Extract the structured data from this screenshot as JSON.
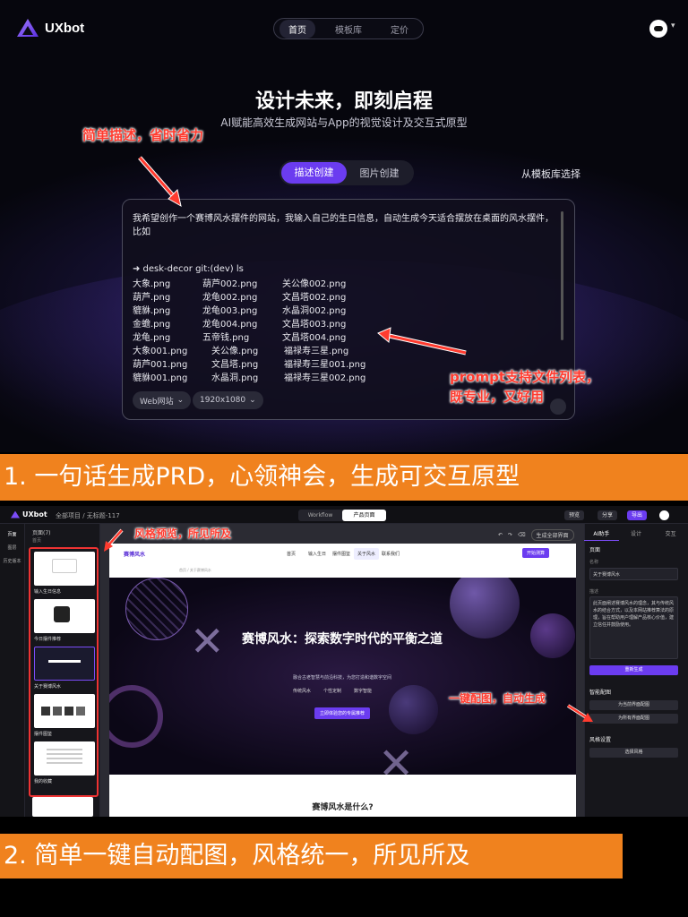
{
  "top": {
    "logo_text": "UXbot",
    "nav": [
      "首页",
      "模板库",
      "定价"
    ],
    "hero_title": "设计未来，即刻启程",
    "hero_subtitle": "AI赋能高效生成网站与App的视觉设计及交互式原型",
    "annotation_1": "简单描述，省时省力",
    "segment": [
      "描述创建",
      "图片创建"
    ],
    "template_link": "从模板库选择",
    "prompt_text": "我希望创作一个赛博风水摆件的网站，我输入自己的生日信息，自动生成今天适合摆放在桌面的风水摆件，比如",
    "command": "➜  desk-decor git:(dev) ls",
    "files": [
      [
        "大象.png",
        "葫芦002.png",
        "关公像002.png"
      ],
      [
        "葫芦.png",
        "龙龟002.png",
        "文昌塔002.png"
      ],
      [
        "貔貅.png",
        "龙龟003.png",
        "水晶洞002.png"
      ],
      [
        "金蟾.png",
        "龙龟004.png",
        "文昌塔003.png"
      ],
      [
        "龙龟.png",
        "五帝钱.png",
        "文昌塔004.png"
      ],
      [
        "大象001.png",
        "关公像.png",
        "福禄寿三星.png"
      ],
      [
        "葫芦001.png",
        "文昌塔.png",
        "福禄寿三星001.png"
      ],
      [
        "貔貅001.png",
        "水晶洞.png",
        "福禄寿三星002.png"
      ]
    ],
    "chip_platform": "Web网站",
    "chip_size": "1920x1080",
    "annotation_2": [
      "prompt支持文件列表，",
      "既专业，又好用"
    ]
  },
  "banner_1": "1. 一句话生成PRD，心领神会，生成可交互原型",
  "editor": {
    "logo_text": "UXbot",
    "breadcrumb": "全部项目 / 无标题-117",
    "toggle": [
      "Workflow",
      "产品页面"
    ],
    "buttons": [
      "预览",
      "分享",
      "导出"
    ],
    "sidebar": [
      "页面",
      "图层",
      "历史版本"
    ],
    "pages_title": "页面(7)",
    "pages_sub": "首页",
    "thumbnails": [
      "输入生日信息",
      "今日摆件推荐",
      "关于赛博风水",
      "摆件图鉴",
      "我的收藏"
    ],
    "canvas_tool_label": "生成全部界面",
    "site": {
      "brand": "赛博风水",
      "nav": [
        "首页",
        "输入生日",
        "摆件图鉴",
        "关于风水",
        "联系我们"
      ],
      "cta_top": "开始测算",
      "crumb": "首页 / 关于赛博风水",
      "hero_title": "赛博风水：探索数字时代的平衡之道",
      "hero_sub": "融合古老智慧与前沿科技，为您打造和谐数字空间",
      "features": [
        "传统风水",
        "个性定制",
        "数字智能"
      ],
      "hero_button": "立即体验您的专属推荐",
      "section_title": "赛博风水是什么?"
    },
    "right_panel": {
      "tabs": [
        "AI助手",
        "设计",
        "交互"
      ],
      "section_page": "页面",
      "name_label": "名称",
      "name_value": "关于赛博风水",
      "desc_label": "描述",
      "desc_value": "此页面阐述赛博风水的理念，其与传统风水的结合方式，以及本网站推荐算法的原理，旨在帮助用户理解产品核心价值，建立信任并鼓励使用。",
      "regen_button": "重新生成",
      "smart_images": "智能配图",
      "img_btn_1": "为当前界面配图",
      "img_btn_2": "为所有界面配图",
      "style_settings": "风格设置",
      "style_btn": "选择风格"
    },
    "annotation_3": "风格预览，所见所及",
    "annotation_4": "一键配图，自动生成"
  },
  "banner_2": "2. 简单一键自动配图，风格统一，所见所及",
  "colors": {
    "accent": "#6b3cf0",
    "banner": "#f0821e",
    "annotation": "#ff3b2f"
  }
}
